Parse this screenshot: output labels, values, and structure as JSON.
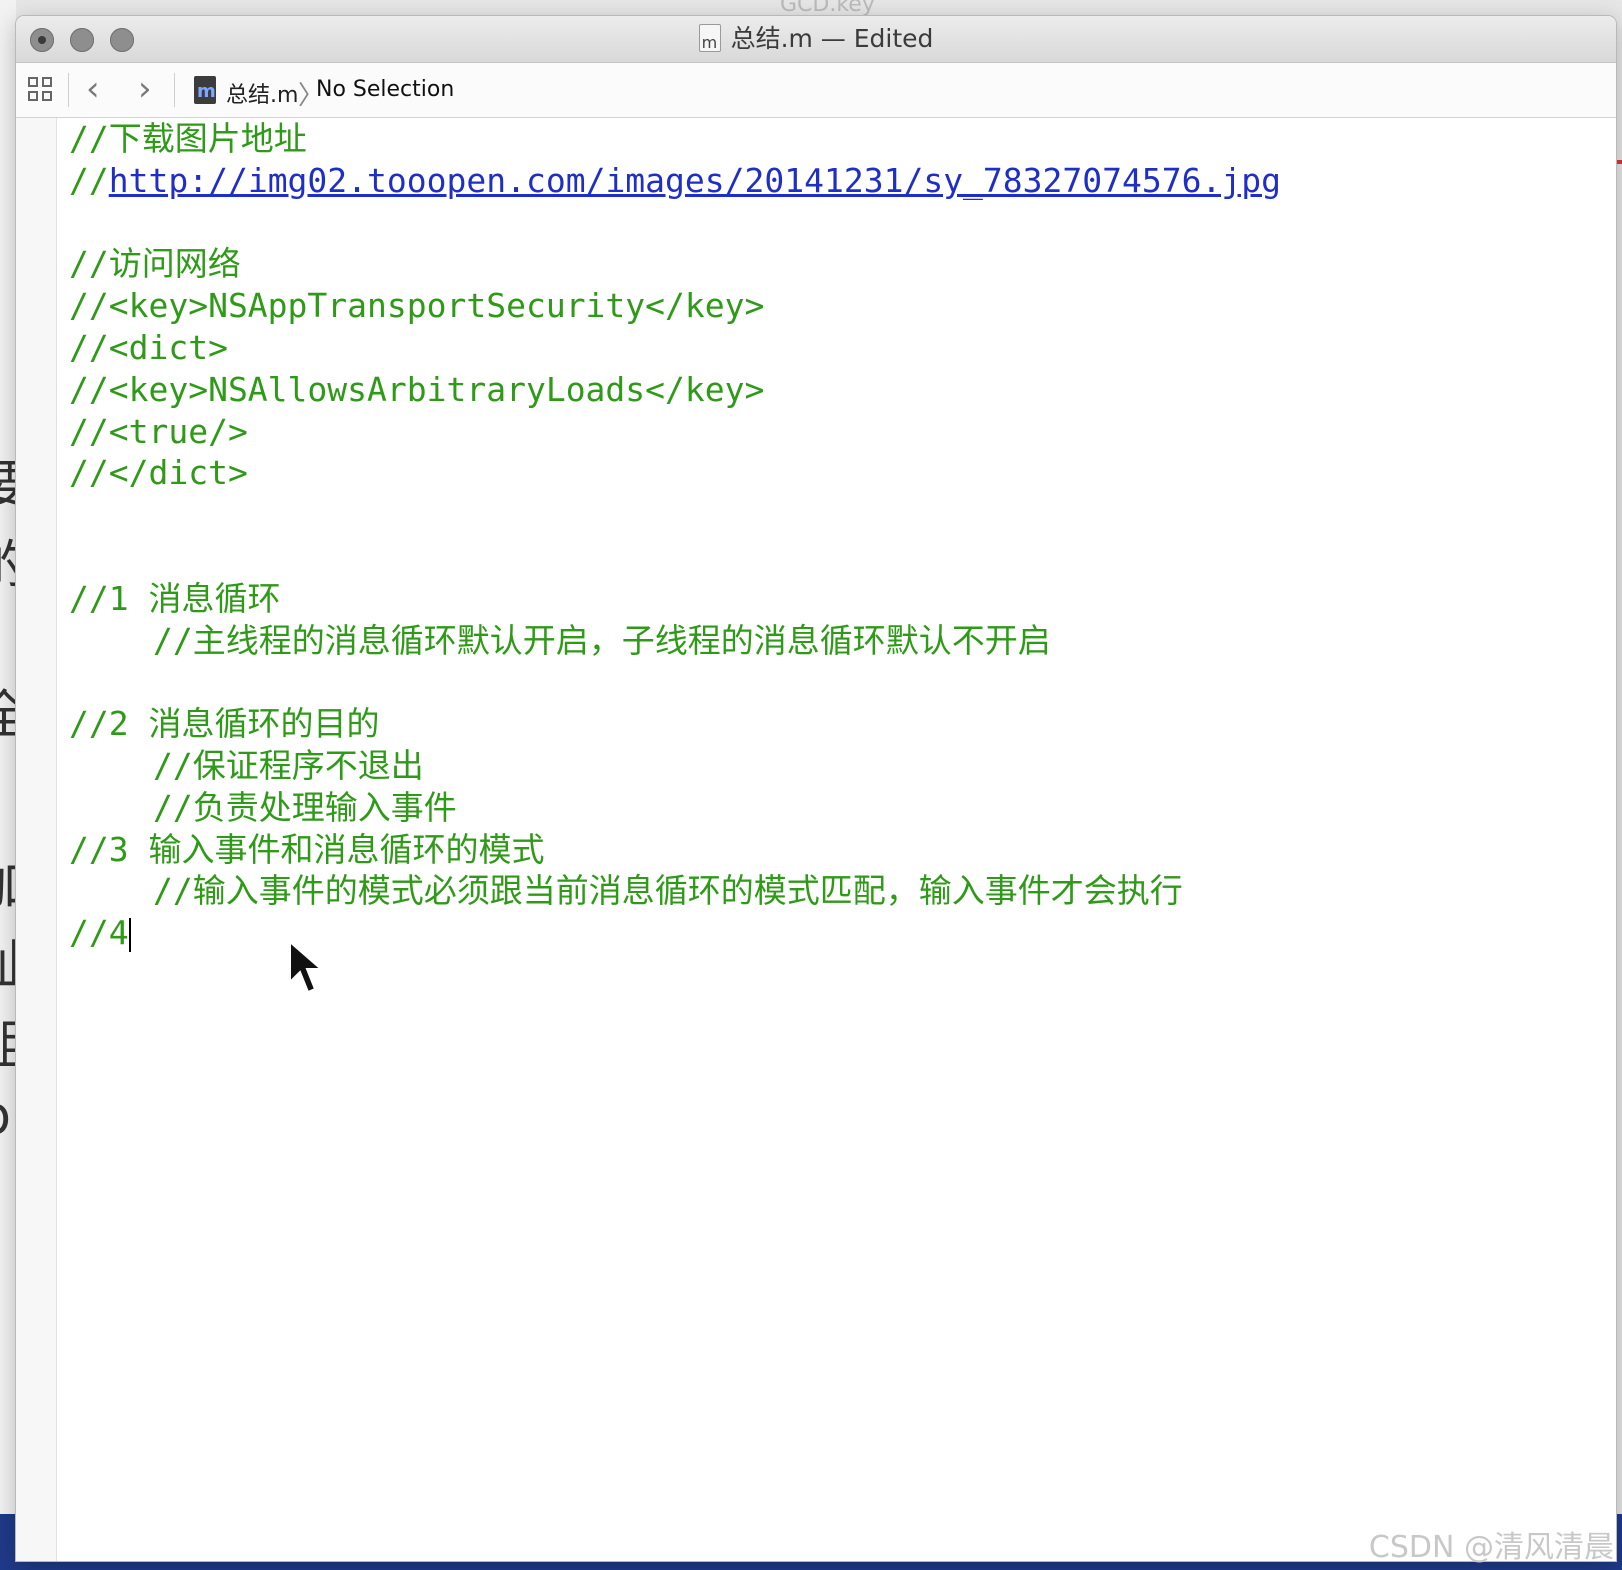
{
  "window": {
    "title": "总结.m — Edited",
    "file_icon_letter": "m"
  },
  "navbar": {
    "breadcrumb_file": "总结.m",
    "breadcrumb_selection": "No Selection",
    "back_glyph": "‹",
    "forward_glyph": "›",
    "file_icon_letter": "m"
  },
  "editor": {
    "lines": [
      {
        "text": "//下载图片地址"
      },
      {
        "prefix": "//",
        "link": "http://img02.tooopen.com/images/20141231/sy_78327074576.jpg"
      },
      {
        "text": ""
      },
      {
        "text": "//访问网络"
      },
      {
        "text": "//<key>NSAppTransportSecurity</key>"
      },
      {
        "text": "//<dict>"
      },
      {
        "text": "//<key>NSAllowsArbitraryLoads</key>"
      },
      {
        "text": "//<true/>"
      },
      {
        "text": "//</dict>"
      },
      {
        "text": ""
      },
      {
        "text": ""
      },
      {
        "text": "//1 消息循环"
      },
      {
        "text": "//主线程的消息循环默认开启，子线程的消息循环默认不开启",
        "indent": true
      },
      {
        "text": ""
      },
      {
        "text": "//2 消息循环的目的"
      },
      {
        "text": "//保证程序不退出",
        "indent": true
      },
      {
        "text": "//负责处理输入事件",
        "indent": true
      },
      {
        "text": "//3 输入事件和消息循环的模式"
      },
      {
        "text": "//输入事件的模式必须跟当前消息循环的模式匹配，输入事件才会执行",
        "indent": true
      },
      {
        "text": "//4",
        "caret": true
      }
    ]
  },
  "watermark": "CSDN @清风清晨",
  "colors": {
    "comment": "#2f9a18",
    "link": "#1f2ec6",
    "titlebar": "#dedede"
  },
  "icons": [
    "grid-icon",
    "back-icon",
    "forward-icon",
    "file-icon",
    "mouse-pointer-icon"
  ]
}
